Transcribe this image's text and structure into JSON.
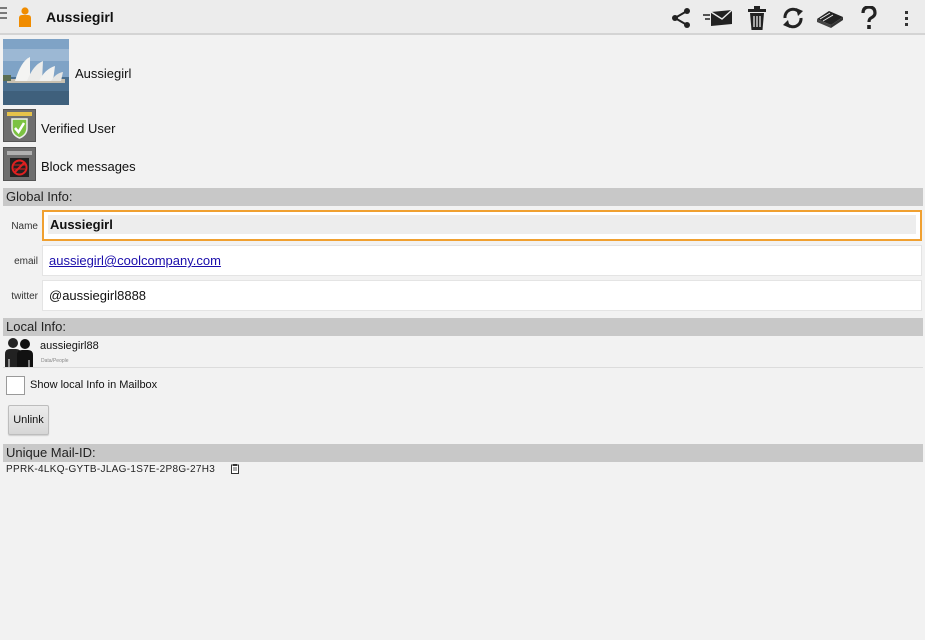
{
  "header": {
    "title": "Aussiegirl",
    "actions": [
      "share-icon",
      "send-mail-icon",
      "delete-icon",
      "refresh-icon",
      "books-icon",
      "help-icon",
      "overflow-menu-icon"
    ]
  },
  "profile": {
    "name": "Aussiegirl",
    "verified_label": "Verified User",
    "block_label": "Block messages"
  },
  "global_info": {
    "header": "Global Info:",
    "fields": [
      {
        "label": "Name",
        "value": "Aussiegirl"
      },
      {
        "label": "email",
        "value": "aussiegirl@coolcompany.com"
      },
      {
        "label": "twitter",
        "value": "@aussiegirl8888"
      }
    ]
  },
  "local_info": {
    "header": "Local Info:",
    "username": "aussiegirl88",
    "subtitle": "Data/People",
    "checkbox_label": "Show local Info in Mailbox",
    "checkbox_checked": false,
    "unlink_label": "Unlink"
  },
  "mail_id": {
    "header": "Unique Mail-ID:",
    "value": "PPRK-4LKQ-GYTB-JLAG-1S7E-2P8G-27H3"
  },
  "colors": {
    "accent_focus": "#f0a030",
    "link": "#1a0dab",
    "app_icon": "#f08c00",
    "verified_green": "#7cc242"
  }
}
